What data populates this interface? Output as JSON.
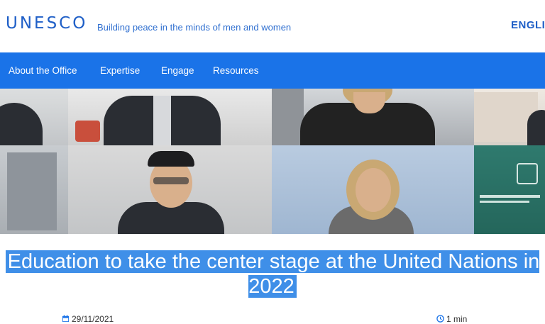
{
  "header": {
    "logo": "UNESCO",
    "tagline": "Building peace in the minds of men and women",
    "language": "ENGLI"
  },
  "nav": {
    "items": [
      "About the Office",
      "Expertise",
      "Engage",
      "Resources"
    ]
  },
  "hero": {
    "icon": "video-call-photo"
  },
  "article": {
    "title": "Education to take the center stage at the United Nations in 2022",
    "date": "29/11/2021",
    "read_time": "1 min"
  },
  "colors": {
    "brand": "#1f5fc7",
    "nav_bg": "#1a73e8",
    "selection": "#3f8fe8"
  }
}
